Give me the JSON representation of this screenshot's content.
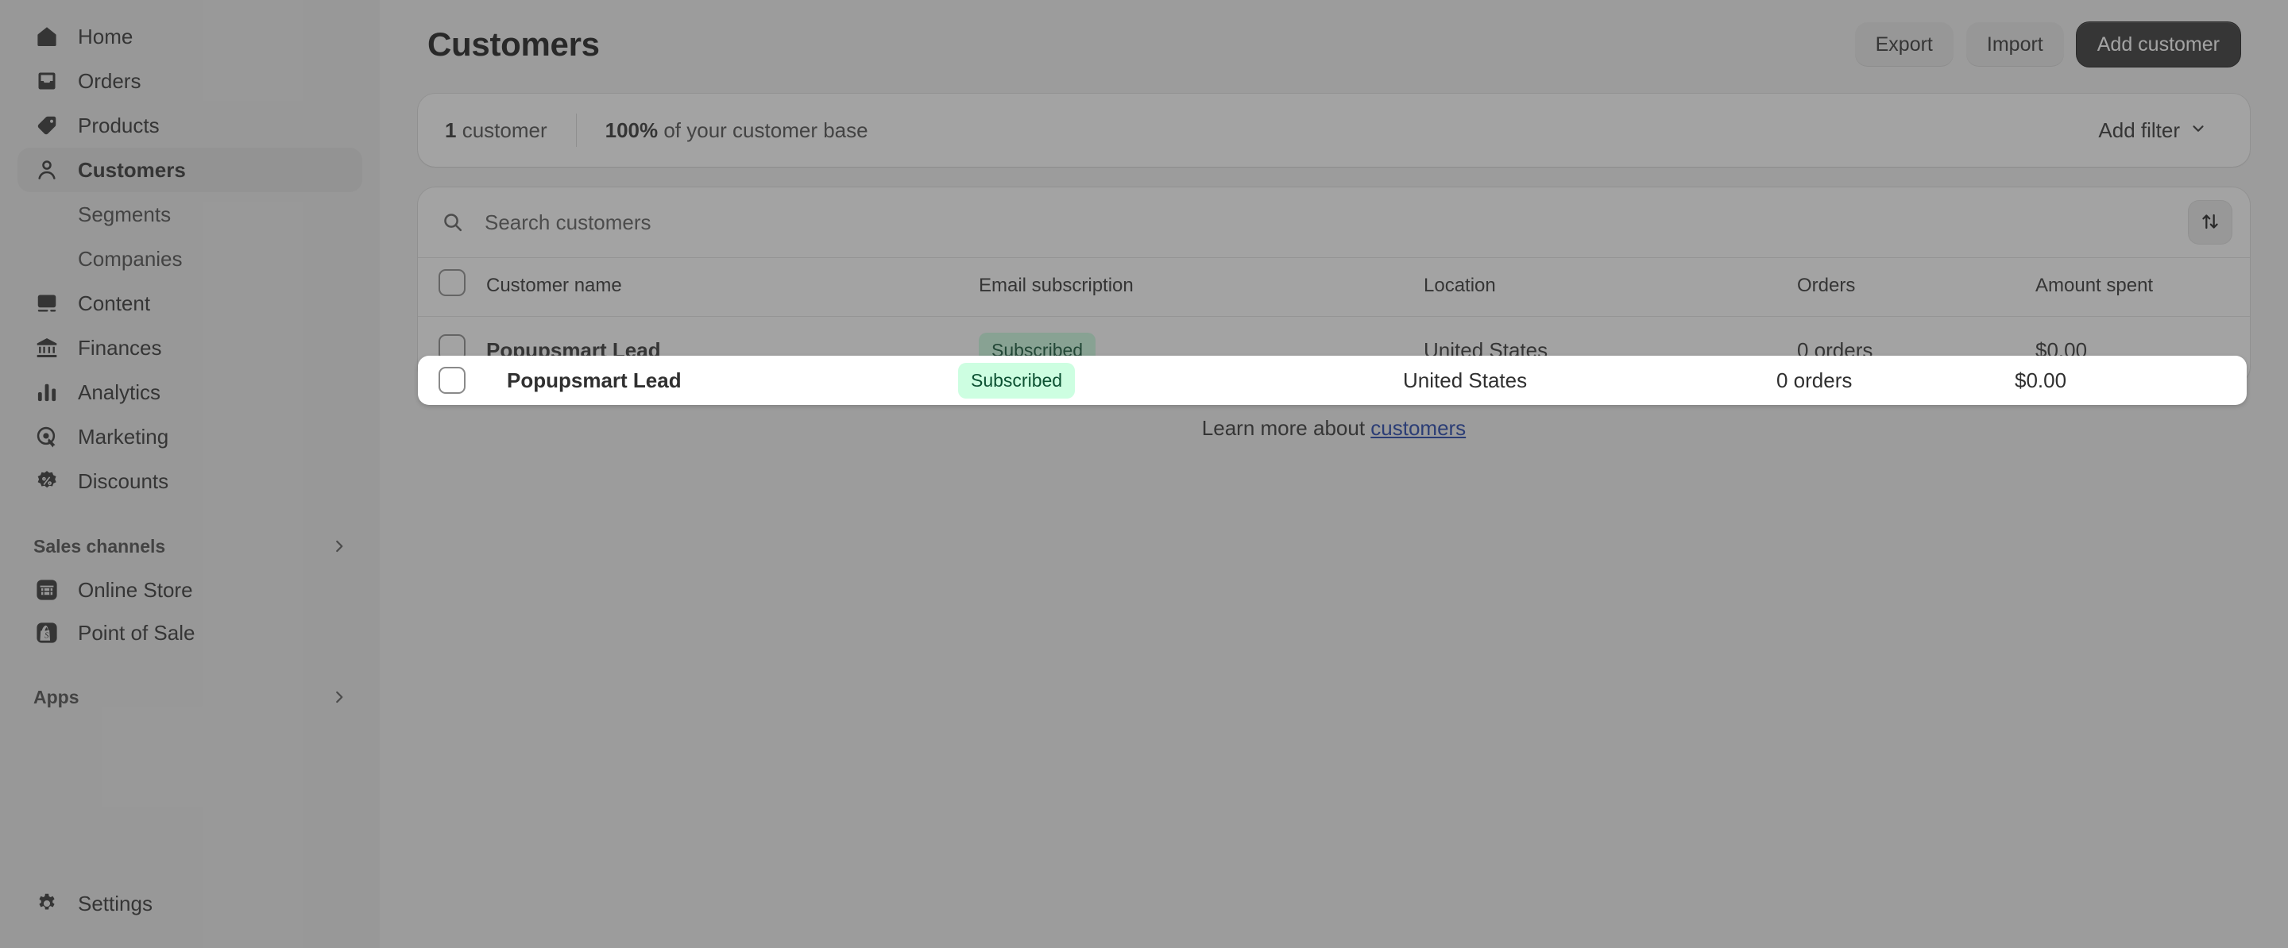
{
  "sidebar": {
    "primary_items": [
      {
        "label": "Home",
        "icon": "home-icon",
        "active": false
      },
      {
        "label": "Orders",
        "icon": "orders-icon",
        "active": false
      },
      {
        "label": "Products",
        "icon": "tag-icon",
        "active": false
      },
      {
        "label": "Customers",
        "icon": "person-icon",
        "active": true
      }
    ],
    "customers_subitems": [
      {
        "label": "Segments"
      },
      {
        "label": "Companies"
      }
    ],
    "secondary_items": [
      {
        "label": "Content",
        "icon": "image-icon"
      },
      {
        "label": "Finances",
        "icon": "bank-icon"
      },
      {
        "label": "Analytics",
        "icon": "bar-chart-icon"
      },
      {
        "label": "Marketing",
        "icon": "target-icon"
      },
      {
        "label": "Discounts",
        "icon": "discount-icon"
      }
    ],
    "sales_channels": {
      "title": "Sales channels",
      "items": [
        {
          "label": "Online Store",
          "icon": "store-icon"
        },
        {
          "label": "Point of Sale",
          "icon": "shopify-bag-icon"
        }
      ]
    },
    "apps": {
      "title": "Apps"
    },
    "settings": {
      "label": "Settings",
      "icon": "gear-icon"
    }
  },
  "header": {
    "title": "Customers",
    "export_label": "Export",
    "import_label": "Import",
    "add_customer_label": "Add customer"
  },
  "summary": {
    "count_value": "1",
    "count_suffix": " customer",
    "percent_value": "100%",
    "percent_suffix": " of your customer base",
    "add_filter_label": "Add filter"
  },
  "search": {
    "placeholder": "Search customers",
    "icon": "search-icon",
    "sort_icon": "sort-arrows-icon"
  },
  "table": {
    "columns": [
      "Customer name",
      "Email subscription",
      "Location",
      "Orders",
      "Amount spent"
    ],
    "rows": [
      {
        "name": "Popupsmart Lead",
        "email_subscription": "Subscribed",
        "location": "United States",
        "orders": "0 orders",
        "amount_spent": "$0.00",
        "highlighted": true
      }
    ]
  },
  "footer": {
    "learn_more_prefix": "Learn more about ",
    "learn_more_link": "customers"
  },
  "colors": {
    "accent_primary": "#323232",
    "badge_bg": "#cdfee1",
    "badge_text": "#0c5132",
    "link": "#1d3fa8",
    "sidebar_bg": "#ebebeb",
    "page_bg": "#f1f1f1"
  }
}
